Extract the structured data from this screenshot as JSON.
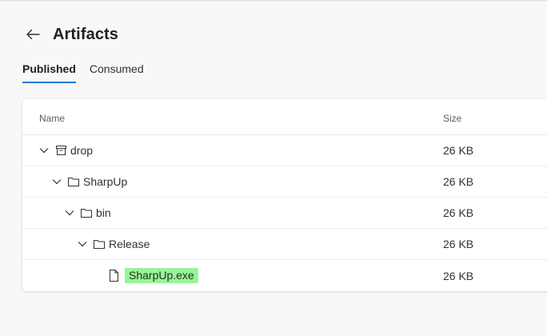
{
  "page": {
    "title": "Artifacts",
    "tabs": [
      {
        "label": "Published",
        "active": true
      },
      {
        "label": "Consumed",
        "active": false
      }
    ]
  },
  "table": {
    "columns": {
      "name": "Name",
      "size": "Size"
    },
    "rows": [
      {
        "name": "drop",
        "size": "26 KB",
        "icon": "artifact-icon",
        "expanded": true,
        "depth": 0
      },
      {
        "name": "SharpUp",
        "size": "26 KB",
        "icon": "folder-icon",
        "expanded": true,
        "depth": 1
      },
      {
        "name": "bin",
        "size": "26 KB",
        "icon": "folder-icon",
        "expanded": true,
        "depth": 2
      },
      {
        "name": "Release",
        "size": "26 KB",
        "icon": "folder-icon",
        "expanded": true,
        "depth": 3
      },
      {
        "name": "SharpUp.exe",
        "size": "26 KB",
        "icon": "file-icon",
        "highlighted": true,
        "depth": 4
      }
    ]
  },
  "colors": {
    "accent": "#0078d4",
    "highlight": "#97f597"
  }
}
